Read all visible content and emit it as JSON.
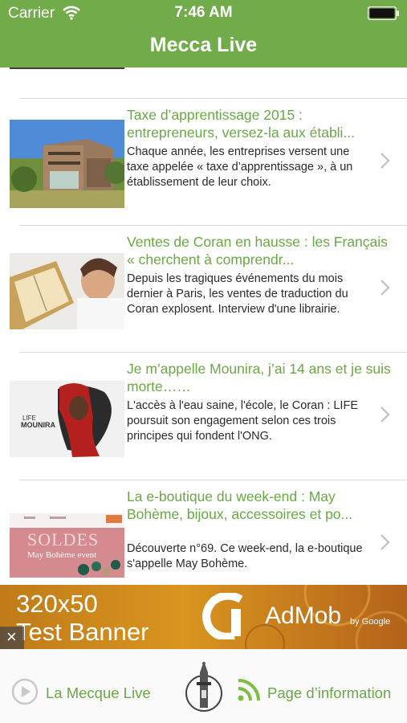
{
  "status_bar": {
    "carrier": "Carrier",
    "time": "7:46 AM"
  },
  "nav": {
    "title": "Mecca Live"
  },
  "articles": [
    {
      "headline": "Taxe d’apprentissage 2015 : entrepreneurs, versez-la aux établi...",
      "summary": "Chaque année, les entreprises versent une taxe appelée « taxe d’apprentissage », à un établissement de leur choix."
    },
    {
      "headline": "Ventes de Coran en hausse : les Français « cherchent à comprendr...",
      "summary": "Depuis les tragiques événements du mois dernier à Paris, les ventes de traduction du Coran explosent. Interview d'une librairie."
    },
    {
      "headline": "Je m’appelle Mounira, j’ai 14 ans et je suis morte……",
      "summary": "L'accès à l'eau saine, l'école, le Coran : LIFE poursuit son engagement selon ces trois principes qui fondent l'ONG.",
      "thumb_text": {
        "brand": "LIFE",
        "name": "MOUNIRA"
      }
    },
    {
      "headline": "La e-boutique du week-end : May Bohème, bijoux, accessoires et po...",
      "summary": "Découverte n°69. Ce week-end, la e-boutique s'appelle May Bohème.",
      "thumb_text": {
        "sale": "SOLDES",
        "shop": "May Bohème event"
      }
    }
  ],
  "ad": {
    "size": "320x50",
    "label": "Test Banner",
    "brand": "AdMob",
    "by": "by Google",
    "close": "×"
  },
  "tabbar": {
    "left_label": "La Mecque Live",
    "right_label": "Page d’information"
  },
  "colors": {
    "accent": "#72ab4a",
    "link": "#6aa844"
  }
}
